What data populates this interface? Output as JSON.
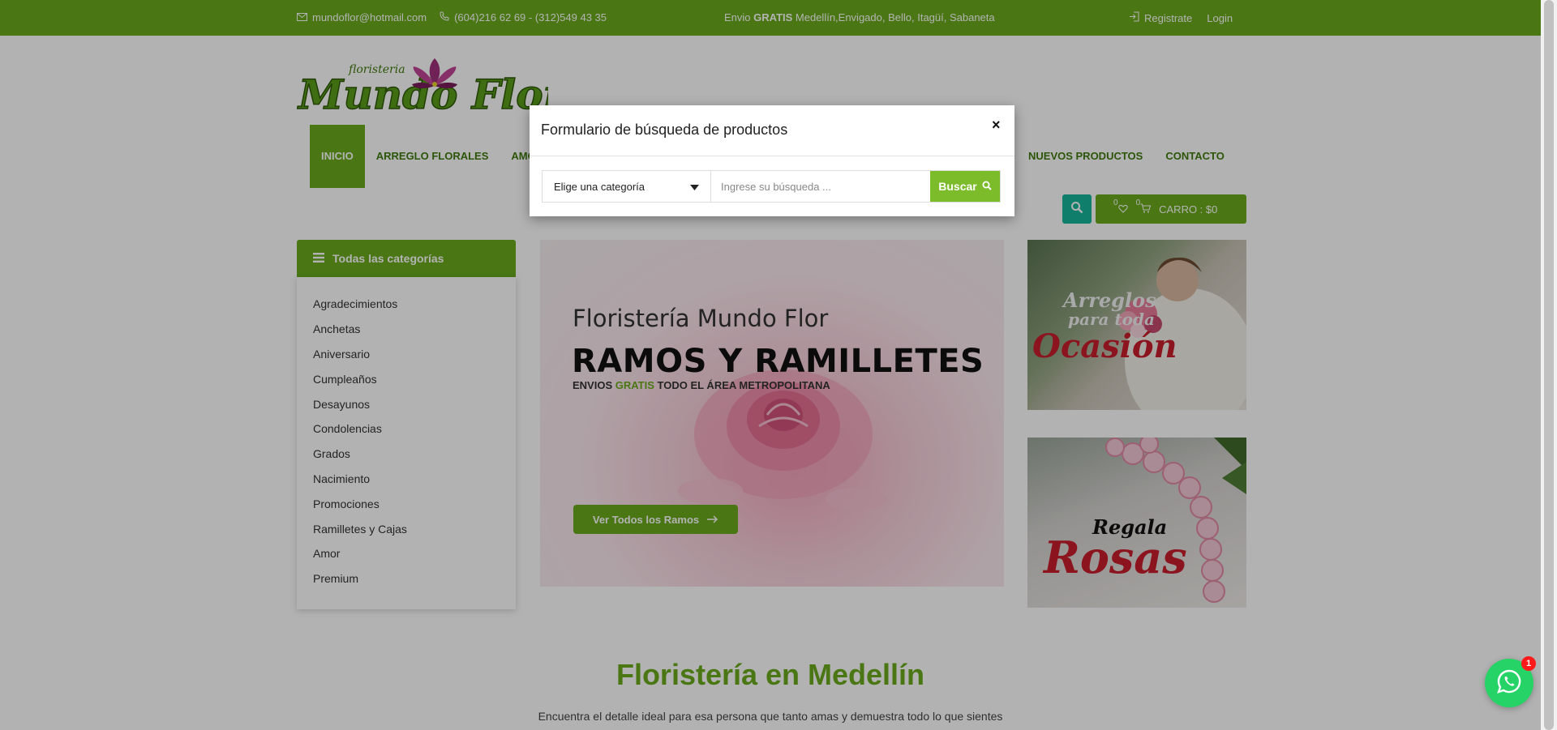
{
  "topbar": {
    "email": "mundoflor@hotmail.com",
    "phone": "(604)216 62 69 - (312)549 43 35",
    "promo_prefix": "Envio ",
    "promo_bold": "GRATIS",
    "promo_suffix": " Medellín,Envigado, Bello, Itagüí, Sabaneta",
    "register": "Registrate",
    "login": "Login"
  },
  "logo": {
    "small": "floristeria",
    "main": "Mundo Flor"
  },
  "nav": {
    "items": [
      "INICIO",
      "ARREGLO FLORALES",
      "AMOR"
    ],
    "right_items": [
      "NUEVOS PRODUCTOS",
      "CONTACTO"
    ]
  },
  "cart": {
    "wishlist_count": "0",
    "cart_count": "0",
    "label": "CARRO : $0"
  },
  "sidebar": {
    "header": "Todas las categorías",
    "categories": [
      "Agradecimientos",
      "Anchetas",
      "Aniversario",
      "Cumpleaños",
      "Desayunos",
      "Condolencias",
      "Grados",
      "Nacimiento",
      "Promociones",
      "Ramilletes y Cajas",
      "Amor",
      "Premium"
    ]
  },
  "hero": {
    "subtitle": "Floristería Mundo Flor",
    "title": "RAMOS Y RAMILLETES",
    "tag_prefix": "ENVIOS ",
    "tag_green": "GRATIS",
    "tag_suffix": " TODO EL ÁREA METROPOLITANA",
    "button": "Ver Todos los Ramos"
  },
  "banners": {
    "b1_line1": "Arreglos",
    "b1_line2": "para toda",
    "b1_line3": "Ocasión",
    "b2_line1": "Regala",
    "b2_line2": "Rosas"
  },
  "section": {
    "title": "Floristería en Medellín",
    "subtitle": "Encuentra el detalle ideal para esa persona que tanto amas y demuestra todo lo que sientes"
  },
  "whatsapp": {
    "badge": "1"
  },
  "modal": {
    "title": "Formulario de búsqueda de productos",
    "close": "×",
    "category_selected": "Elige una categoría",
    "search_placeholder": "Ingrese su búsqueda ...",
    "search_button": "Buscar"
  },
  "colors": {
    "brand_green": "#6aab1e",
    "teal": "#16b79a",
    "title_green": "#6aab1e"
  }
}
